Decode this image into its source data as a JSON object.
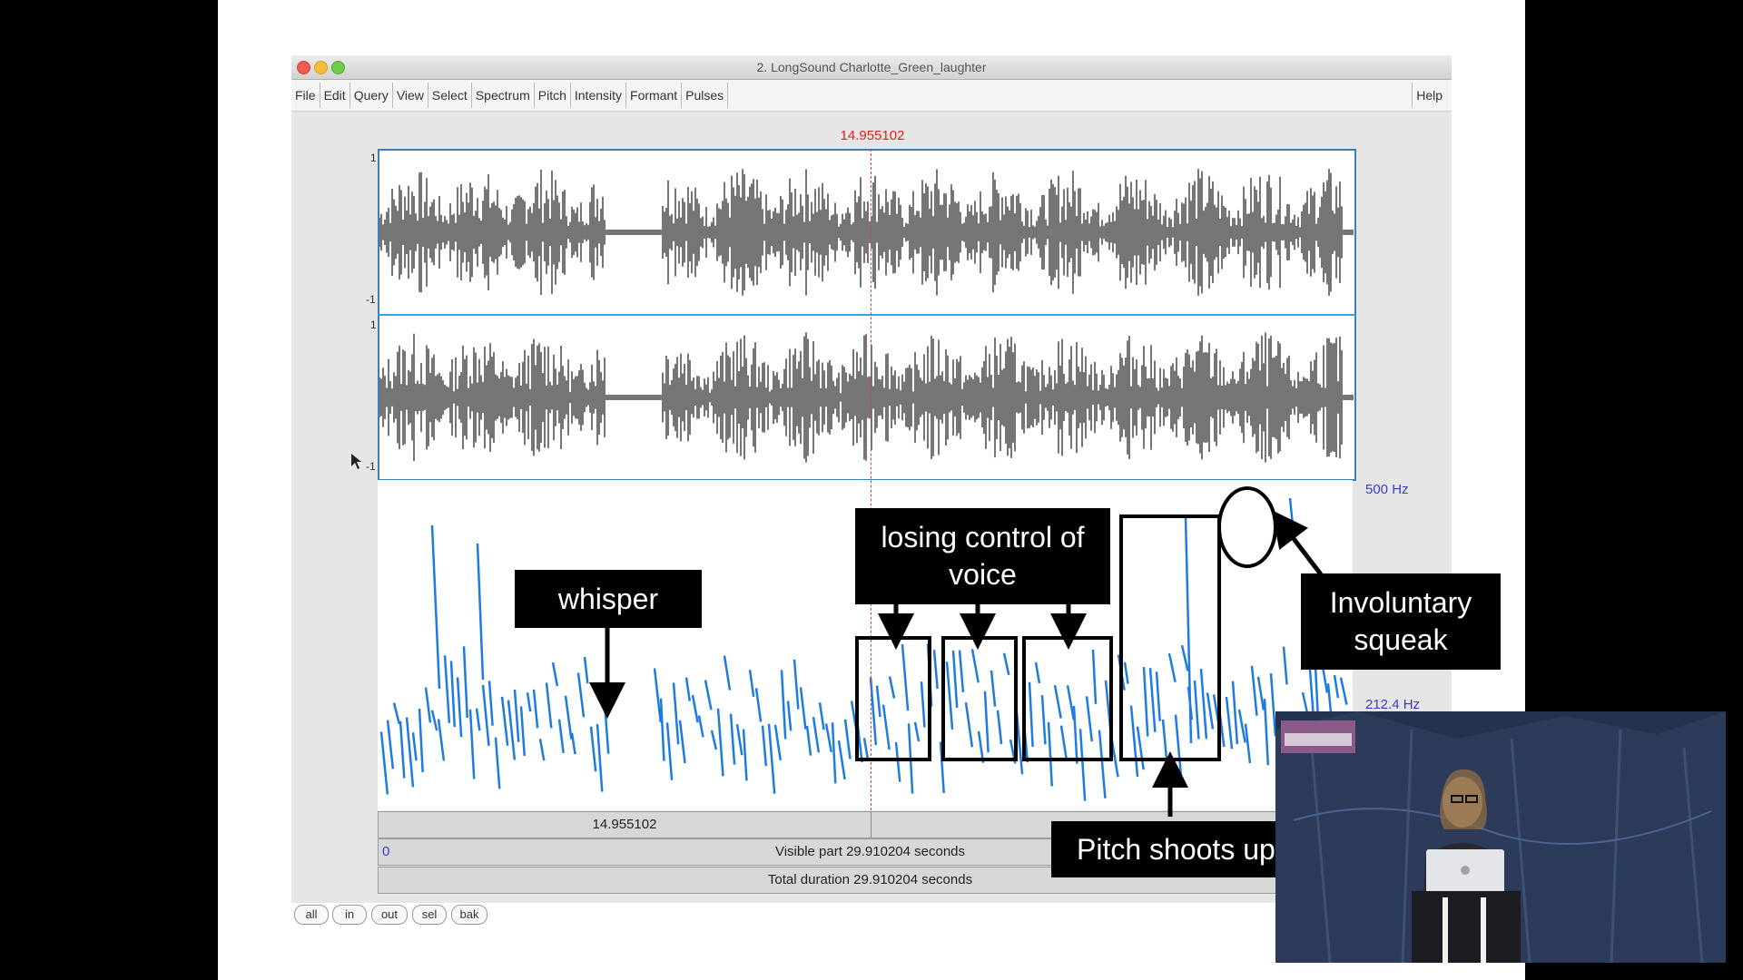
{
  "window": {
    "title": "2. LongSound Charlotte_Green_laughter",
    "menu": [
      "File",
      "Edit",
      "Query",
      "View",
      "Select",
      "Spectrum",
      "Pitch",
      "Intensity",
      "Formant",
      "Pulses"
    ],
    "help": "Help"
  },
  "cursor_time": "14.955102",
  "waveform": {
    "ch1_top": "1",
    "ch1_bottom": "-1",
    "ch2_top": "1",
    "ch2_bottom": "-1"
  },
  "pitch": {
    "top_label": "500 Hz",
    "mid_label": "212.4 Hz"
  },
  "time_bars": {
    "left_time": "14.955102",
    "visible_start": "0",
    "visible": "Visible part 29.910204 seconds",
    "total": "Total duration 29.910204 seconds"
  },
  "bottom_buttons": [
    "all",
    "in",
    "out",
    "sel",
    "bak"
  ],
  "annotations": {
    "whisper": "whisper",
    "losing_line1": "losing control of",
    "losing_line2": "voice",
    "involuntary_line1": "Involuntary",
    "involuntary_line2": "squeak",
    "pitch_shoots": "Pitch shoots up"
  },
  "colors": {
    "waveform": "#1a1a1a",
    "pitch_curve": "#1e7be0",
    "cursor": "#e02020",
    "hz_label": "#3b3bcf"
  }
}
